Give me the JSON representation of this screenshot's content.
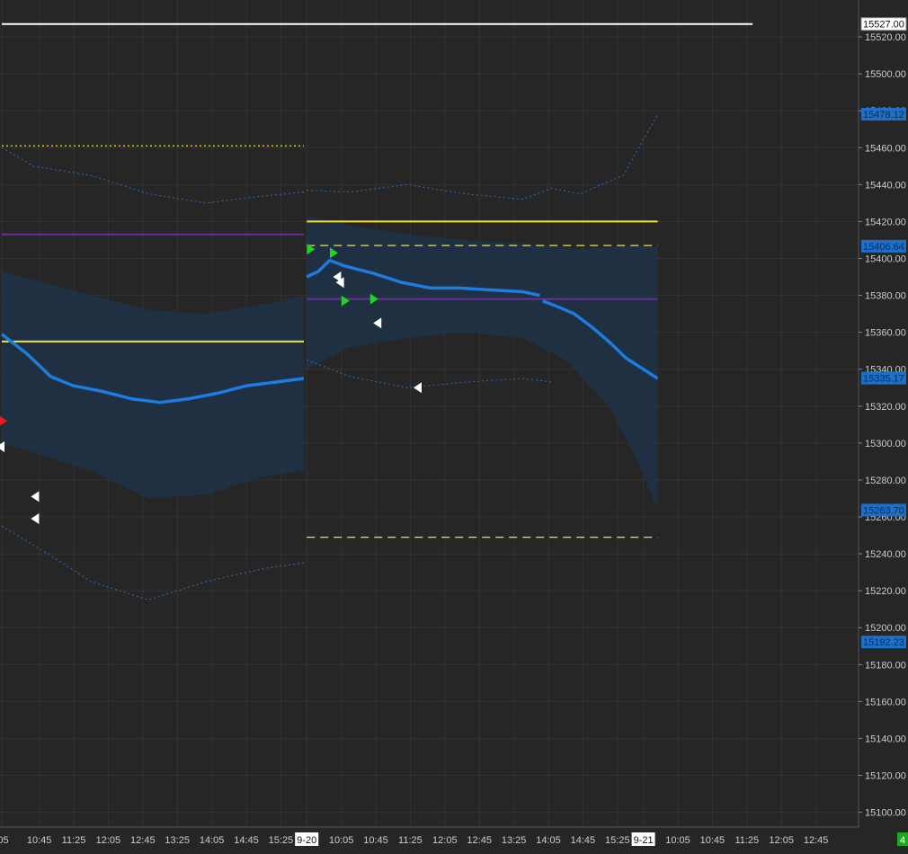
{
  "chart_data": {
    "type": "candlestick",
    "instrument_hint": "",
    "colors": {
      "background": "#262626",
      "grid": "#333333",
      "axis_text": "#cccccc",
      "up": "#21c721",
      "down": "#d62121",
      "vwap": "#1e7be0",
      "band_fill": "#1d3246",
      "band_dot": "#2f6fb8",
      "yellow": "#f2e33a",
      "purple": "#6a2ea0",
      "white_line": "#ffffff",
      "green_marker": "#22d422",
      "white_marker": "#ffffff",
      "red_marker": "#e02020"
    },
    "yaxis": {
      "min": 15092,
      "max": 15540,
      "ticks": [
        15100,
        15120,
        15140,
        15160,
        15180,
        15200,
        15220,
        15240,
        15260,
        15280,
        15300,
        15320,
        15340,
        15360,
        15380,
        15400,
        15420,
        15440,
        15460,
        15480,
        15500,
        15520
      ],
      "tick_labels": [
        "15100.00",
        "15120.00",
        "15140.00",
        "15160.00",
        "15180.00",
        "15200.00",
        "15220.00",
        "15240.00",
        "15260.00",
        "15280.00",
        "15300.00",
        "15320.00",
        "15340.00",
        "15360.00",
        "15380.00",
        "15400.00",
        "15420.00",
        "15440.00",
        "15460.00",
        "15480.00",
        "15500.00",
        "15520.00"
      ],
      "price_tags": [
        {
          "value": 15527.0,
          "label": "15527.00",
          "style": "white"
        },
        {
          "value": 15478.12,
          "label": "15478.12",
          "style": "blue"
        },
        {
          "value": 15406.64,
          "label": "15406.64",
          "style": "blue"
        },
        {
          "value": 15335.17,
          "label": "15335.17",
          "style": "blue"
        },
        {
          "value": 15263.7,
          "label": "15263.70",
          "style": "blue"
        },
        {
          "value": 15192.23,
          "label": "15192.23",
          "style": "blue"
        }
      ]
    },
    "xaxis": {
      "bar_index_min": -21,
      "bar_index_max": 240,
      "ticks": [
        {
          "i": -21,
          "label": ":05"
        },
        {
          "i": -8,
          "label": "10:45"
        },
        {
          "i": 4,
          "label": "11:25"
        },
        {
          "i": 16,
          "label": "12:05"
        },
        {
          "i": 28,
          "label": "12:45"
        },
        {
          "i": 40,
          "label": "13:25"
        },
        {
          "i": 52,
          "label": "14:05"
        },
        {
          "i": 64,
          "label": "14:45"
        },
        {
          "i": 76,
          "label": "15:25"
        },
        {
          "i": 85,
          "label": "9-20",
          "session": true
        },
        {
          "i": 97,
          "label": "10:05"
        },
        {
          "i": 109,
          "label": "10:45"
        },
        {
          "i": 121,
          "label": "11:25"
        },
        {
          "i": 133,
          "label": "12:05"
        },
        {
          "i": 145,
          "label": "12:45"
        },
        {
          "i": 157,
          "label": "13:25"
        },
        {
          "i": 169,
          "label": "14:05"
        },
        {
          "i": 181,
          "label": "14:45"
        },
        {
          "i": 193,
          "label": "15:25"
        },
        {
          "i": 202,
          "label": "9-21",
          "session": true
        },
        {
          "i": 214,
          "label": "10:05"
        },
        {
          "i": 226,
          "label": "10:45"
        },
        {
          "i": 238,
          "label": "11:25"
        },
        {
          "i": 250,
          "label": "12:05"
        },
        {
          "i": 262,
          "label": "12:45"
        }
      ],
      "corner_label": "4"
    },
    "anchors": [
      {
        "i": -21,
        "price": 15300
      },
      {
        "i": -18,
        "price": 15312
      },
      {
        "i": -14,
        "price": 15285
      },
      {
        "i": -10,
        "price": 15262
      },
      {
        "i": -6,
        "price": 15255
      },
      {
        "i": -2,
        "price": 15268
      },
      {
        "i": 2,
        "price": 15285
      },
      {
        "i": 6,
        "price": 15278
      },
      {
        "i": 10,
        "price": 15270
      },
      {
        "i": 14,
        "price": 15285
      },
      {
        "i": 18,
        "price": 15278
      },
      {
        "i": 22,
        "price": 15282
      },
      {
        "i": 26,
        "price": 15275
      },
      {
        "i": 30,
        "price": 15270
      },
      {
        "i": 34,
        "price": 15290
      },
      {
        "i": 38,
        "price": 15318
      },
      {
        "i": 42,
        "price": 15332
      },
      {
        "i": 46,
        "price": 15345
      },
      {
        "i": 50,
        "price": 15368
      },
      {
        "i": 54,
        "price": 15378
      },
      {
        "i": 58,
        "price": 15372
      },
      {
        "i": 62,
        "price": 15382
      },
      {
        "i": 64,
        "price": 15402
      },
      {
        "i": 67,
        "price": 15375
      },
      {
        "i": 70,
        "price": 15350
      },
      {
        "i": 73,
        "price": 15343
      },
      {
        "i": 76,
        "price": 15355
      },
      {
        "i": 80,
        "price": 15372
      },
      {
        "i": 84,
        "price": 15385
      },
      {
        "i": 87,
        "price": 15405
      },
      {
        "i": 90,
        "price": 15420
      },
      {
        "i": 93,
        "price": 15410
      },
      {
        "i": 96,
        "price": 15385
      },
      {
        "i": 99,
        "price": 15372
      },
      {
        "i": 103,
        "price": 15380
      },
      {
        "i": 107,
        "price": 15375
      },
      {
        "i": 110,
        "price": 15362
      },
      {
        "i": 114,
        "price": 15345
      },
      {
        "i": 118,
        "price": 15333
      },
      {
        "i": 121,
        "price": 15340
      },
      {
        "i": 124,
        "price": 15370
      },
      {
        "i": 128,
        "price": 15373
      },
      {
        "i": 132,
        "price": 15368
      },
      {
        "i": 136,
        "price": 15376
      },
      {
        "i": 140,
        "price": 15378
      },
      {
        "i": 145,
        "price": 15380
      },
      {
        "i": 150,
        "price": 15376
      },
      {
        "i": 154,
        "price": 15372
      },
      {
        "i": 158,
        "price": 15365
      },
      {
        "i": 162,
        "price": 15360
      },
      {
        "i": 165,
        "price": 15374
      },
      {
        "i": 167,
        "price": 15350
      },
      {
        "i": 169,
        "price": 15310
      },
      {
        "i": 171,
        "price": 15325
      },
      {
        "i": 174,
        "price": 15310
      },
      {
        "i": 177,
        "price": 15335
      },
      {
        "i": 179,
        "price": 15360
      },
      {
        "i": 181,
        "price": 15340
      },
      {
        "i": 184,
        "price": 15318
      },
      {
        "i": 187,
        "price": 15298
      },
      {
        "i": 190,
        "price": 15275
      },
      {
        "i": 193,
        "price": 15240
      },
      {
        "i": 196,
        "price": 15250
      },
      {
        "i": 198,
        "price": 15225
      },
      {
        "i": 200,
        "price": 15200
      },
      {
        "i": 203,
        "price": 15180
      },
      {
        "i": 205,
        "price": 15190
      },
      {
        "i": 207,
        "price": 15155
      }
    ],
    "candle_count_first_index": -21,
    "candle_count_last_index": 207,
    "session_gap": [
      84,
      85
    ],
    "vwap_series": [
      {
        "segment": 1,
        "points": [
          [
            -21,
            15359
          ],
          [
            -12,
            15348
          ],
          [
            -4,
            15336
          ],
          [
            4,
            15331
          ],
          [
            14,
            15328
          ],
          [
            24,
            15324
          ],
          [
            34,
            15322
          ],
          [
            44,
            15324
          ],
          [
            54,
            15327
          ],
          [
            64,
            15331
          ],
          [
            74,
            15333
          ],
          [
            84,
            15335
          ]
        ]
      },
      {
        "segment": 2,
        "points": [
          [
            85,
            15390
          ],
          [
            89,
            15393
          ],
          [
            93,
            15399
          ],
          [
            98,
            15396
          ],
          [
            108,
            15392
          ],
          [
            118,
            15387
          ],
          [
            128,
            15384
          ],
          [
            138,
            15384
          ],
          [
            148,
            15383
          ],
          [
            160,
            15382
          ],
          [
            166,
            15380
          ]
        ]
      },
      {
        "segment": 3,
        "points": [
          [
            167,
            15377
          ],
          [
            172,
            15374
          ],
          [
            178,
            15370
          ],
          [
            184,
            15363
          ],
          [
            190,
            15355
          ],
          [
            196,
            15346
          ],
          [
            202,
            15340
          ],
          [
            207,
            15335
          ]
        ]
      }
    ],
    "band_inner": {
      "s1_upper": [
        [
          -21,
          15393
        ],
        [
          10,
          15380
        ],
        [
          30,
          15372
        ],
        [
          50,
          15370
        ],
        [
          70,
          15375
        ],
        [
          84,
          15380
        ]
      ],
      "s1_lower": [
        [
          -21,
          15300
        ],
        [
          10,
          15285
        ],
        [
          30,
          15270
        ],
        [
          50,
          15272
        ],
        [
          70,
          15282
        ],
        [
          84,
          15285
        ]
      ],
      "s2_upper": [
        [
          85,
          15423
        ],
        [
          100,
          15418
        ],
        [
          120,
          15413
        ],
        [
          140,
          15410
        ],
        [
          160,
          15408
        ],
        [
          180,
          15405
        ],
        [
          200,
          15407
        ],
        [
          207,
          15406
        ]
      ],
      "s2_lower": [
        [
          85,
          15340
        ],
        [
          100,
          15352
        ],
        [
          120,
          15357
        ],
        [
          140,
          15360
        ],
        [
          160,
          15357
        ],
        [
          175,
          15345
        ],
        [
          190,
          15320
        ],
        [
          200,
          15290
        ],
        [
          207,
          15264
        ]
      ]
    },
    "band_outer_dotted": {
      "s1_upper": [
        [
          -21,
          15460
        ],
        [
          -10,
          15450
        ],
        [
          10,
          15445
        ],
        [
          30,
          15435
        ],
        [
          50,
          15430
        ],
        [
          65,
          15433
        ],
        [
          84,
          15436
        ]
      ],
      "s1_lower": [
        [
          -21,
          15255
        ],
        [
          -5,
          15240
        ],
        [
          10,
          15225
        ],
        [
          30,
          15215
        ],
        [
          50,
          15225
        ],
        [
          70,
          15232
        ],
        [
          84,
          15235
        ]
      ],
      "s2_upper": [
        [
          85,
          15437
        ],
        [
          100,
          15436
        ],
        [
          120,
          15440
        ],
        [
          140,
          15435
        ],
        [
          160,
          15432
        ],
        [
          170,
          15438
        ],
        [
          180,
          15435
        ],
        [
          195,
          15445
        ],
        [
          207,
          15478
        ]
      ],
      "s2_lower": [
        [
          85,
          15345
        ],
        [
          100,
          15336
        ],
        [
          120,
          15330
        ],
        [
          140,
          15333
        ],
        [
          160,
          15335
        ],
        [
          170,
          15333
        ]
      ]
    },
    "level_lines": [
      {
        "name": "yellow-dotted-top",
        "value": 15461,
        "i_from": -21,
        "i_to": 84,
        "style": "dotted",
        "color_key": "yellow"
      },
      {
        "name": "purple-1",
        "value": 15413,
        "i_from": -21,
        "i_to": 84,
        "style": "solid",
        "color_key": "purple"
      },
      {
        "name": "yellow-solid-1",
        "value": 15355,
        "i_from": -21,
        "i_to": 84,
        "style": "solid",
        "color_key": "yellow"
      },
      {
        "name": "yellow-solid-2",
        "value": 15420,
        "i_from": 85,
        "i_to": 207,
        "style": "solid",
        "color_key": "yellow"
      },
      {
        "name": "yellow-dash-2a",
        "value": 15407,
        "i_from": 85,
        "i_to": 207,
        "style": "dashed",
        "color_key": "yellow"
      },
      {
        "name": "purple-2",
        "value": 15378,
        "i_from": 85,
        "i_to": 207,
        "style": "solid",
        "color_key": "purple"
      },
      {
        "name": "yellow-dash-2b",
        "value": 15249,
        "i_from": 85,
        "i_to": 207,
        "style": "dashed",
        "color_key": "yellow"
      },
      {
        "name": "white-top",
        "value": 15527,
        "i_from": -21,
        "i_to": 240,
        "style": "solid",
        "color_key": "white_line"
      }
    ],
    "markers": [
      {
        "i": -21,
        "price": 15312,
        "kind": "red-right"
      },
      {
        "i": -21,
        "price": 15298,
        "kind": "white-left"
      },
      {
        "i": -9,
        "price": 15271,
        "kind": "white-left"
      },
      {
        "i": -9,
        "price": 15259,
        "kind": "white-left"
      },
      {
        "i": 86,
        "price": 15405,
        "kind": "green-right"
      },
      {
        "i": 94,
        "price": 15403,
        "kind": "green-right"
      },
      {
        "i": 96,
        "price": 15390,
        "kind": "white-left"
      },
      {
        "i": 97,
        "price": 15387,
        "kind": "white-left"
      },
      {
        "i": 98,
        "price": 15377,
        "kind": "green-right"
      },
      {
        "i": 108,
        "price": 15378,
        "kind": "green-right"
      },
      {
        "i": 110,
        "price": 15365,
        "kind": "white-left"
      },
      {
        "i": 124,
        "price": 15330,
        "kind": "white-left"
      }
    ]
  }
}
